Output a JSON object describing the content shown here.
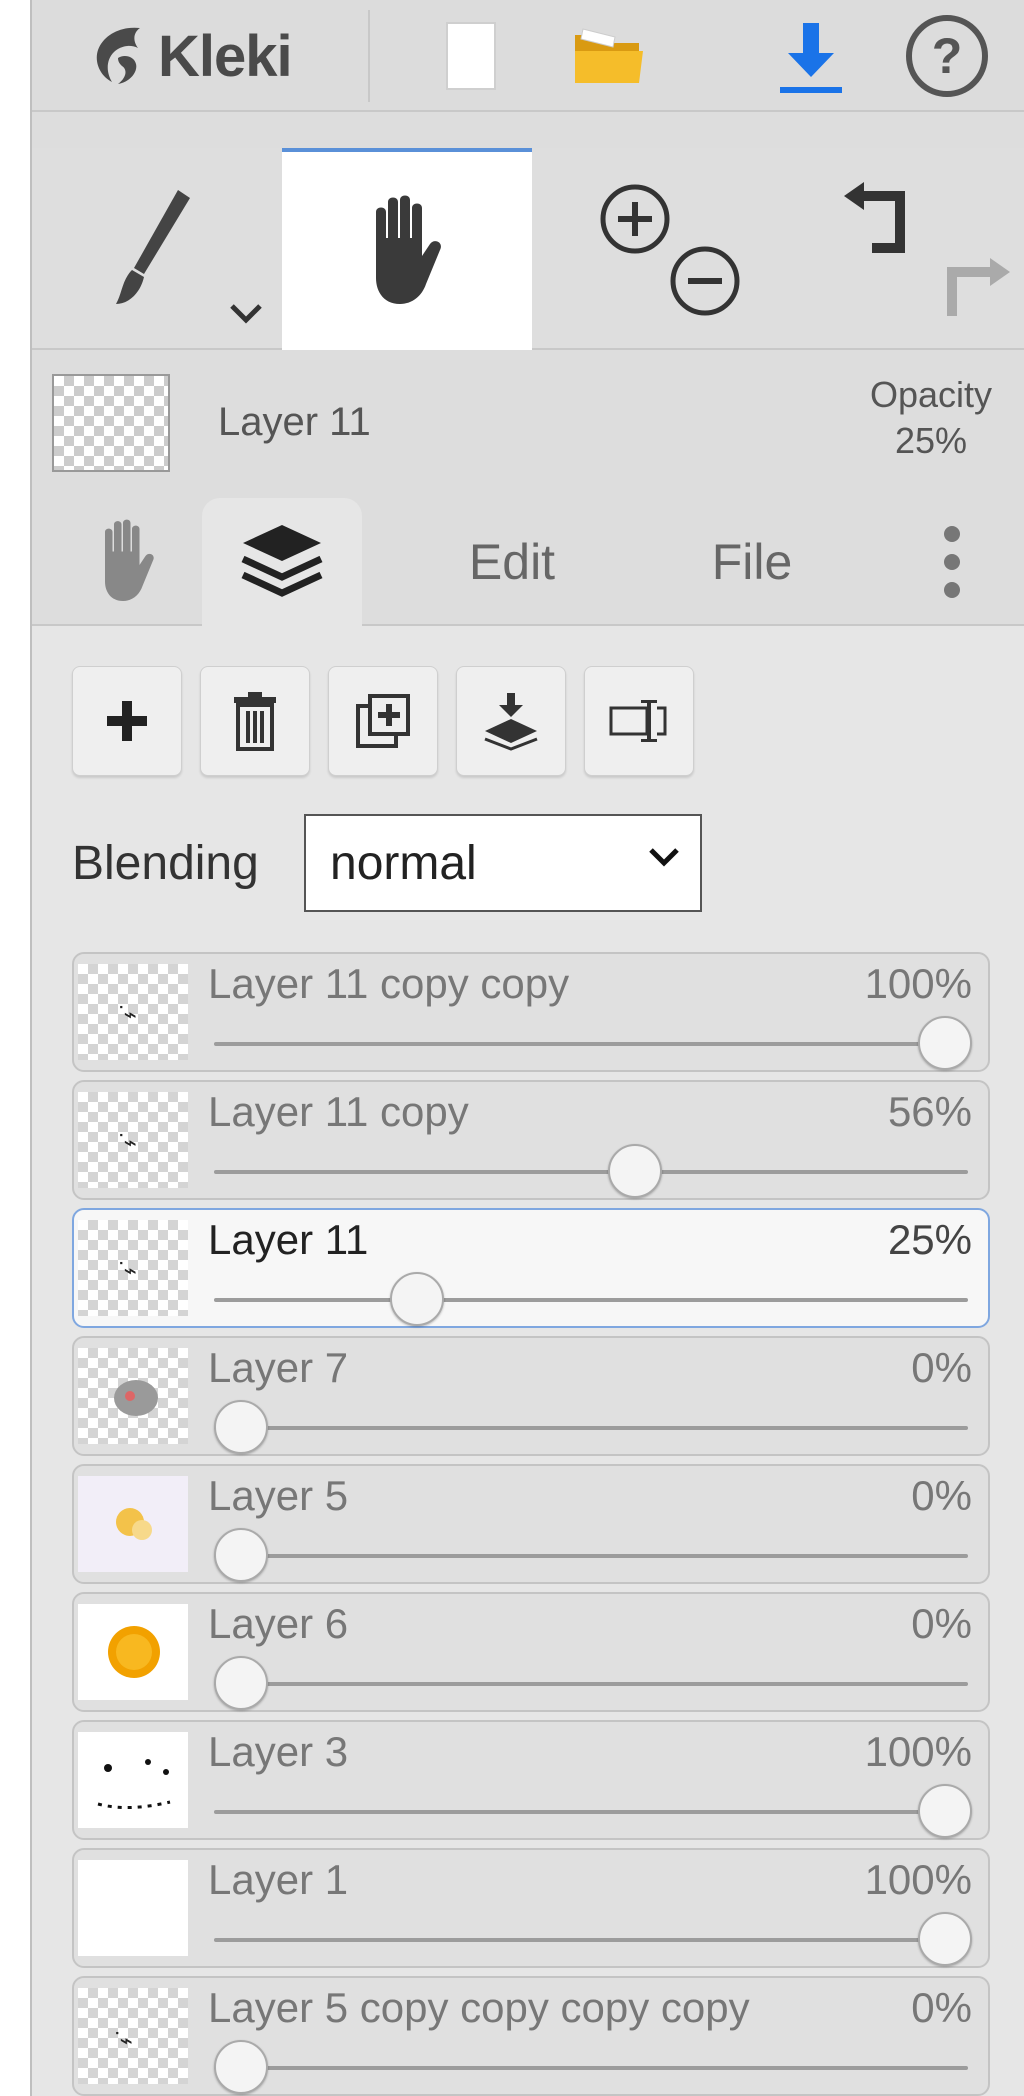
{
  "app": {
    "name": "Kleki"
  },
  "toolbar": {
    "new_icon": "new-image-icon",
    "open_icon": "open-folder-icon",
    "save_icon": "download-icon",
    "help_icon": "help-icon",
    "accent_color": "#1a73e8"
  },
  "tools": {
    "active": "hand",
    "items": [
      "brush-icon",
      "hand-icon",
      "zoom-in-icon",
      "zoom-out-icon",
      "undo-icon",
      "redo-icon"
    ]
  },
  "current_layer": {
    "name": "Layer 11",
    "opacity_label": "Opacity",
    "opacity_value": "25%"
  },
  "tabs": {
    "active": "layers",
    "edit": "Edit",
    "file": "File"
  },
  "layers_panel": {
    "actions": [
      "add-layer-icon",
      "delete-layer-icon",
      "duplicate-layer-icon",
      "merge-down-icon",
      "rename-layer-icon"
    ],
    "blending_label": "Blending",
    "blending_value": "normal",
    "layers": [
      {
        "name": "Layer 11 copy copy",
        "opacity": "100%",
        "value": 1.0,
        "active": false
      },
      {
        "name": "Layer 11 copy",
        "opacity": "56%",
        "value": 0.56,
        "active": false
      },
      {
        "name": "Layer 11",
        "opacity": "25%",
        "value": 0.25,
        "active": true
      },
      {
        "name": "Layer 7",
        "opacity": "0%",
        "value": 0.0,
        "active": false
      },
      {
        "name": "Layer 5",
        "opacity": "0%",
        "value": 0.0,
        "active": false
      },
      {
        "name": "Layer 6",
        "opacity": "0%",
        "value": 0.0,
        "active": false
      },
      {
        "name": "Layer 3",
        "opacity": "100%",
        "value": 1.0,
        "active": false
      },
      {
        "name": "Layer 1",
        "opacity": "100%",
        "value": 1.0,
        "active": false
      },
      {
        "name": "Layer 5 copy copy copy copy",
        "opacity": "0%",
        "value": 0.0,
        "active": false
      }
    ]
  }
}
